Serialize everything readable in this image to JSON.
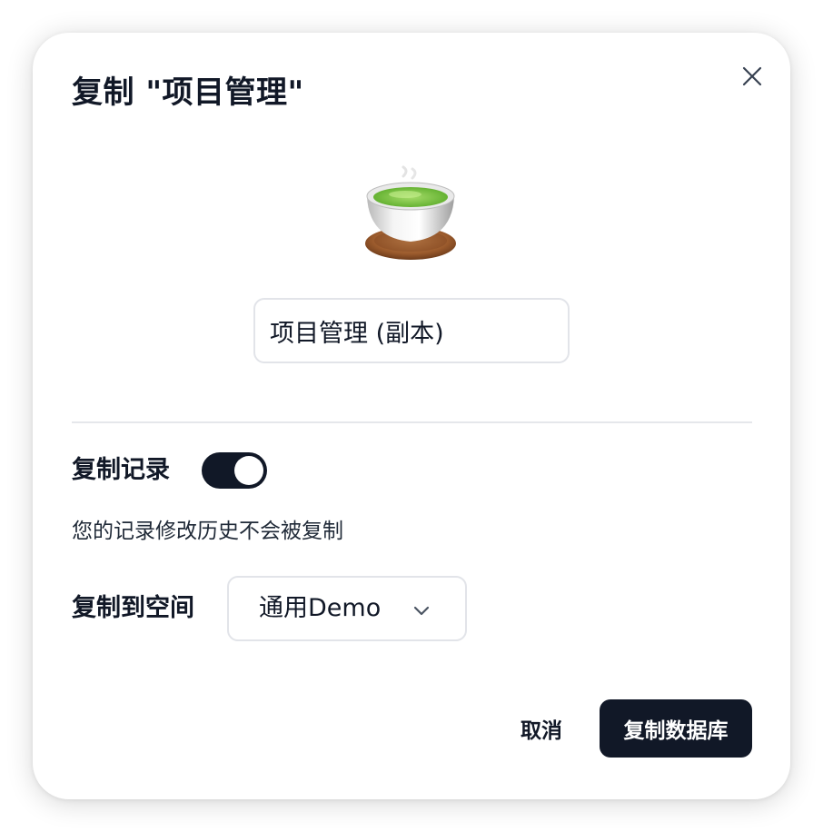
{
  "dialog": {
    "title": "复制 \"项目管理\"",
    "close_icon": "close-icon",
    "database_icon": "teacup-emoji-icon",
    "name_input_value": "项目管理 (副本)",
    "copy_records": {
      "label": "复制记录",
      "enabled": true,
      "hint": "您的记录修改历史不会被复制"
    },
    "copy_to_space": {
      "label": "复制到空间",
      "selected": "通用Demo",
      "chevron_icon": "chevron-down-icon"
    },
    "buttons": {
      "cancel_label": "取消",
      "submit_label": "复制数据库"
    },
    "colors": {
      "primary": "#111827",
      "border": "#e2e4e9",
      "divider": "#e5e7eb"
    }
  }
}
